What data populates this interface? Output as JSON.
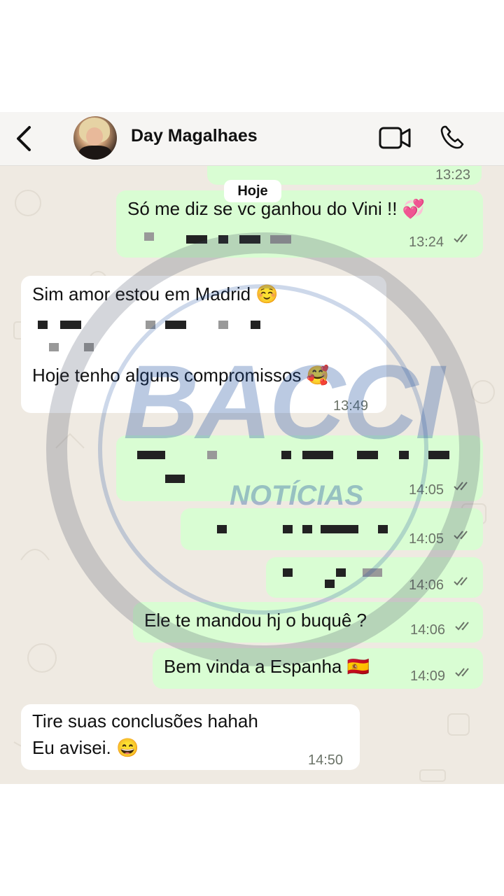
{
  "header": {
    "contact_name": "Day Magalhaes",
    "back_icon": "chevron-left-icon",
    "video_icon": "video-camera-icon",
    "call_icon": "phone-icon"
  },
  "date_chip": "Hoje",
  "prev_time": "13:23",
  "messages": [
    {
      "dir": "out",
      "text": "Só me diz se vc ganhou do Vini !! 💞",
      "time": "13:24",
      "status": "read"
    },
    {
      "dir": "in",
      "line1": "Sim amor estou em Madrid ☺️",
      "line2": "Hoje tenho alguns compromissos 🥰",
      "time": "13:49"
    },
    {
      "dir": "out",
      "text": "",
      "time": "14:05",
      "status": "read"
    },
    {
      "dir": "out",
      "text": "",
      "time": "14:05",
      "status": "read"
    },
    {
      "dir": "out",
      "text": "",
      "time": "14:06",
      "status": "read"
    },
    {
      "dir": "out",
      "text": "Ele te mandou hj o buquê ?",
      "time": "14:06",
      "status": "read"
    },
    {
      "dir": "out",
      "text": "Bem vinda a Espanha 🇪🇸",
      "time": "14:09",
      "status": "read"
    },
    {
      "dir": "in",
      "line1": "Tire suas conclusões hahah",
      "line2": "Eu avisei. 😄",
      "time": "14:50"
    }
  ],
  "watermark": {
    "brand": "BACCI",
    "sub": "NOTÍCIAS",
    "color": "#1d4fa0"
  }
}
